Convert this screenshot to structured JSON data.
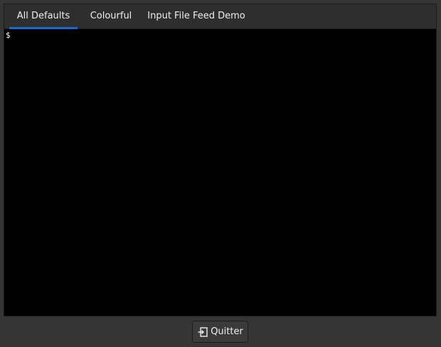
{
  "tabs": [
    {
      "label": "All Defaults",
      "active": true
    },
    {
      "label": "Colourful",
      "active": false
    },
    {
      "label": "Input File Feed Demo",
      "active": false
    }
  ],
  "terminal": {
    "prompt": "$",
    "background_color": "#000000",
    "text_color": "#ffffff"
  },
  "quit_button": {
    "label": "Quitter",
    "icon": "exit-icon"
  },
  "colors": {
    "accent": "#1b6acb",
    "window_bg": "#353535"
  }
}
